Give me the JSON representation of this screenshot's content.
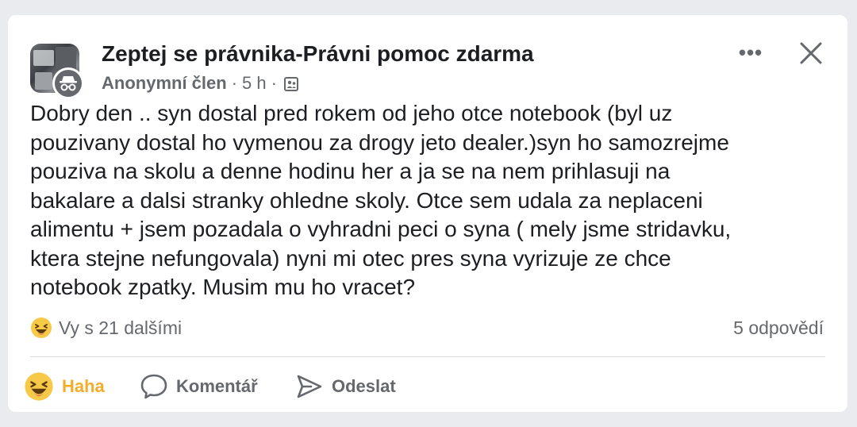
{
  "post": {
    "group_name": "Zeptej se právnika-Právni pomoc zdarma",
    "author": "Anonymní člen",
    "separator": "·",
    "time": "5 h",
    "body": "Dobry den .. syn dostal pred rokem od jeho otce notebook (byl uz\npouzivany dostal ho vymenou za drogy jeto dealer.)syn ho samozrejme\npouziva na skolu a denne hodinu her a ja se na nem prihlasuji na\nbakalare a dalsi stranky ohledne skoly. Otce sem udala za neplaceni\nalimentu + jsem pozadala o vyhradni peci o syna ( mely jsme stridavku,\nktera stejne nefungovala) nyni mi otec pres syna vyrizuje ze chce\nnotebook zpatky. Musim mu ho vracet?"
  },
  "header_actions": {
    "more_label": "•••",
    "more_icon": "more-horizontal-icon",
    "close_icon": "close-icon"
  },
  "stats": {
    "reaction_icon": "haha-emoji-icon",
    "reactions_text": "Vy s 21 dalšími",
    "comments_text": "5 odpovědí"
  },
  "actions": {
    "haha_label": "Haha",
    "comment_label": "Komentář",
    "send_label": "Odeslat"
  },
  "colors": {
    "text_primary": "#1c1e21",
    "text_secondary": "#65686c",
    "haha_active": "#f2ad2b",
    "card_bg": "#ffffff",
    "page_bg": "#e9ebee"
  }
}
